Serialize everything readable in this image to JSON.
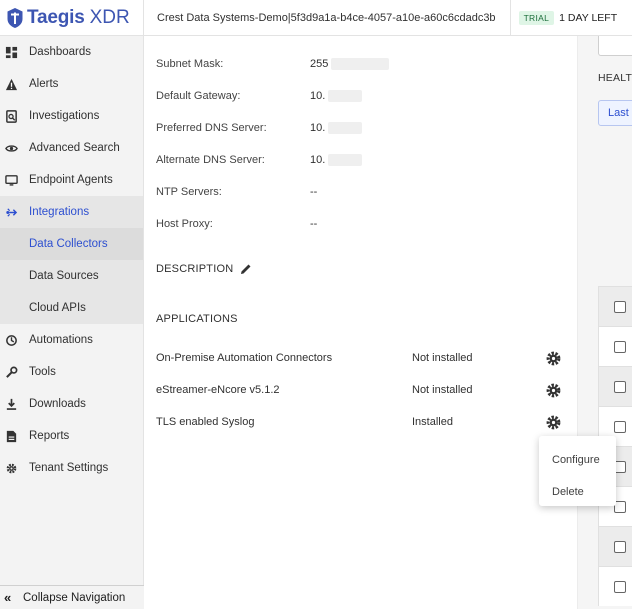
{
  "brand": {
    "name": "Taegis",
    "product": "XDR",
    "color": "#3d56b2"
  },
  "topbar": {
    "tenant": "Crest Data Systems-Demo|5f3d9a1a-b4ce-4057-a10e-a60c6cdadc3b",
    "trial_badge": "TRIAL",
    "trial_text": "1 DAY LEFT"
  },
  "sidebar": {
    "items": [
      {
        "label": "Dashboards",
        "icon": "dashboard-icon"
      },
      {
        "label": "Alerts",
        "icon": "alert-icon"
      },
      {
        "label": "Investigations",
        "icon": "investigation-icon"
      },
      {
        "label": "Advanced Search",
        "icon": "search-eye-icon"
      },
      {
        "label": "Endpoint Agents",
        "icon": "monitor-icon"
      },
      {
        "label": "Integrations",
        "icon": "integrations-icon"
      },
      {
        "label": "Automations",
        "icon": "automation-icon"
      },
      {
        "label": "Tools",
        "icon": "wrench-icon"
      },
      {
        "label": "Downloads",
        "icon": "download-icon"
      },
      {
        "label": "Reports",
        "icon": "report-icon"
      },
      {
        "label": "Tenant Settings",
        "icon": "gear-icon"
      }
    ],
    "sub_items": [
      {
        "label": "Data Collectors"
      },
      {
        "label": "Data Sources"
      },
      {
        "label": "Cloud APIs"
      }
    ],
    "collapse_label": "Collapse Navigation"
  },
  "network": {
    "subnet_mask": {
      "label": "Subnet Mask:",
      "value": "255"
    },
    "default_gateway": {
      "label": "Default Gateway:",
      "value": "10."
    },
    "preferred_dns": {
      "label": "Preferred DNS Server:",
      "value": "10."
    },
    "alternate_dns": {
      "label": "Alternate DNS Server:",
      "value": "10."
    },
    "ntp_servers": {
      "label": "NTP Servers:",
      "value": "--"
    },
    "host_proxy": {
      "label": "Host Proxy:",
      "value": "--"
    }
  },
  "description": {
    "title": "DESCRIPTION"
  },
  "applications": {
    "title": "APPLICATIONS",
    "rows": [
      {
        "name": "On-Premise Automation Connectors",
        "status": "Not installed"
      },
      {
        "name": "eStreamer-eNcore v5.1.2",
        "status": "Not installed"
      },
      {
        "name": "TLS enabled Syslog",
        "status": "Installed"
      }
    ]
  },
  "context_menu": {
    "configure": "Configure",
    "delete": "Delete"
  },
  "right_panel": {
    "heading": "HEALT",
    "button_label": "Last"
  },
  "colors": {
    "accent": "#2d4fd0",
    "trial_bg": "#dff5e6"
  }
}
